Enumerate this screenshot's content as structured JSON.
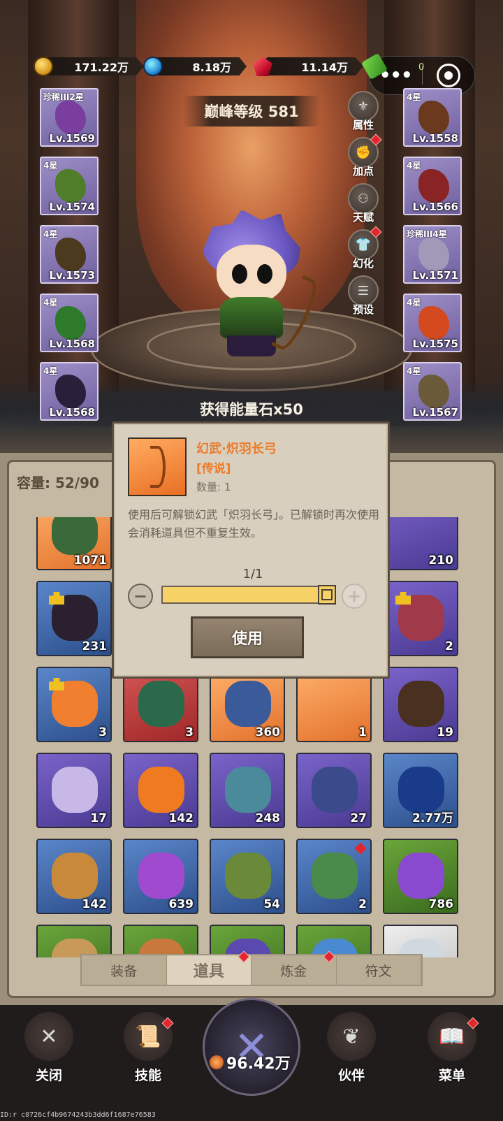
{
  "top_bar": {
    "gold": "171.22万",
    "diamond": "8.18万",
    "ruby": "11.14万",
    "ticket": "0",
    "capsule_more": "•••"
  },
  "peak_level": "巅峰等级 581",
  "equipment_left": [
    {
      "star": "珍稀III2星",
      "level": "Lv.1569",
      "color": "#7a3f9e"
    },
    {
      "star": "4星",
      "level": "Lv.1574",
      "color": "#4f7d2a"
    },
    {
      "star": "4星",
      "level": "Lv.1573",
      "color": "#4b3a1e"
    },
    {
      "star": "4星",
      "level": "Lv.1568",
      "color": "#2d7a2a"
    },
    {
      "star": "4星",
      "level": "Lv.1568",
      "color": "#2a1f3a"
    }
  ],
  "equipment_right": [
    {
      "star": "4星",
      "level": "Lv.1558",
      "color": "#6b3a1e"
    },
    {
      "star": "4星",
      "level": "Lv.1566",
      "color": "#8a2424"
    },
    {
      "star": "珍稀III4星",
      "level": "Lv.1571",
      "color": "#a09ab8"
    },
    {
      "star": "4星",
      "level": "Lv.1575",
      "color": "#d44a1e"
    },
    {
      "star": "4星",
      "level": "Lv.1567",
      "color": "#6b5a3a"
    }
  ],
  "side_buttons": [
    {
      "label": "属性",
      "icon": "attribute-icon",
      "glyph": "⚜",
      "dot": false
    },
    {
      "label": "加点",
      "icon": "add-points-icon",
      "glyph": "✊",
      "dot": true
    },
    {
      "label": "天赋",
      "icon": "talent-icon",
      "glyph": "⚇",
      "dot": false
    },
    {
      "label": "幻化",
      "icon": "transform-icon",
      "glyph": "👕",
      "dot": true
    },
    {
      "label": "预设",
      "icon": "preset-icon",
      "glyph": "☰",
      "dot": false
    }
  ],
  "notice": "获得能量石x50",
  "capacity": "容量: 52/90",
  "items": [
    {
      "color": "orange",
      "count": "1071",
      "badge": false,
      "dot": false,
      "art": "#3a6a3a"
    },
    {
      "color": "purple",
      "count": "",
      "badge": false,
      "dot": false,
      "art": ""
    },
    {
      "color": "purple",
      "count": "",
      "badge": false,
      "dot": false,
      "art": ""
    },
    {
      "color": "purple",
      "count": "",
      "badge": false,
      "dot": false,
      "art": ""
    },
    {
      "color": "purple",
      "count": "210",
      "badge": false,
      "dot": false,
      "art": ""
    },
    {
      "color": "blue",
      "count": "231",
      "badge": true,
      "dot": false,
      "art": "#2a2030"
    },
    {
      "color": "purple",
      "count": "",
      "badge": false,
      "dot": false,
      "art": ""
    },
    {
      "color": "purple",
      "count": "",
      "badge": false,
      "dot": false,
      "art": ""
    },
    {
      "color": "purple",
      "count": "",
      "badge": false,
      "dot": false,
      "art": ""
    },
    {
      "color": "purple",
      "count": "2",
      "badge": true,
      "dot": false,
      "art": "#a03a4a"
    },
    {
      "color": "blue",
      "count": "3",
      "badge": true,
      "dot": false,
      "art": "#f08030"
    },
    {
      "color": "red",
      "count": "3",
      "badge": false,
      "dot": false,
      "art": "#2a6a4a"
    },
    {
      "color": "orange",
      "count": "360",
      "badge": false,
      "dot": false,
      "art": "#3a5a9a"
    },
    {
      "color": "orange",
      "count": "1",
      "badge": false,
      "dot": false,
      "art": ""
    },
    {
      "color": "purple",
      "count": "19",
      "badge": false,
      "dot": false,
      "art": "#4a3020"
    },
    {
      "color": "purple",
      "count": "17",
      "badge": false,
      "dot": false,
      "art": "#c8b8e8"
    },
    {
      "color": "purple",
      "count": "142",
      "badge": false,
      "dot": false,
      "art": "#f07a20"
    },
    {
      "color": "purple",
      "count": "248",
      "badge": false,
      "dot": false,
      "art": "#4a8a9a"
    },
    {
      "color": "purple",
      "count": "27",
      "badge": false,
      "dot": false,
      "art": "#3a4a8a"
    },
    {
      "color": "blue",
      "count": "2.77万",
      "badge": false,
      "dot": false,
      "art": "#1a3a8a"
    },
    {
      "color": "blue",
      "count": "142",
      "badge": false,
      "dot": false,
      "art": "#c88a3a"
    },
    {
      "color": "blue",
      "count": "639",
      "badge": false,
      "dot": false,
      "art": "#a04ad0"
    },
    {
      "color": "blue",
      "count": "54",
      "badge": false,
      "dot": false,
      "art": "#6a8a3a"
    },
    {
      "color": "blue",
      "count": "2",
      "badge": false,
      "dot": true,
      "art": "#4a8a4a"
    },
    {
      "color": "green",
      "count": "786",
      "badge": false,
      "dot": false,
      "art": "#8a4ad0"
    },
    {
      "color": "green",
      "count": "",
      "badge": false,
      "dot": false,
      "art": "#c89a5a"
    },
    {
      "color": "green",
      "count": "",
      "badge": false,
      "dot": false,
      "art": "#c8783a"
    },
    {
      "color": "green",
      "count": "",
      "badge": false,
      "dot": false,
      "art": "#5a4ab0"
    },
    {
      "color": "green",
      "count": "",
      "badge": false,
      "dot": false,
      "art": "#4a8ad0"
    },
    {
      "color": "white",
      "count": "",
      "badge": false,
      "dot": false,
      "art": "#d0d8e0"
    }
  ],
  "tabs": [
    {
      "label": "装备",
      "active": false,
      "dot": false
    },
    {
      "label": "道具",
      "active": true,
      "dot": true
    },
    {
      "label": "炼金",
      "active": false,
      "dot": true
    },
    {
      "label": "符文",
      "active": false,
      "dot": false
    }
  ],
  "nav": {
    "close": "关闭",
    "skill": "技能",
    "battle_power": "96.42万",
    "partner": "伙伴",
    "menu": "菜单"
  },
  "modal": {
    "title": "幻武·炽羽长弓",
    "rarity": "[传说]",
    "quantity": "数量: 1",
    "description": "使用后可解锁幻武「炽羽长弓」。已解锁时再次使用会消耗道具但不重复生效。",
    "fraction": "1/1",
    "progress": 1.0,
    "use_label": "使用"
  },
  "footer_id": "ID:r c0726cf4b9674243b3dd6f1687e76583"
}
